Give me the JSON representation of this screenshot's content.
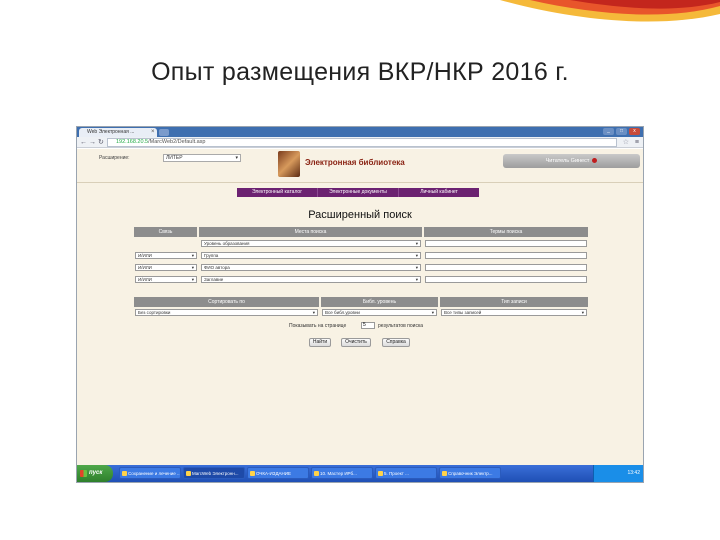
{
  "slide": {
    "title": "Опыт размещения ВКР/НКР 2016 г."
  },
  "browser": {
    "tab_title": "Web Электронная ...",
    "url_host": "192.168.20.5",
    "url_rest": "/MarcWeb2/Default.asp",
    "window_buttons": [
      "_",
      "□",
      "x"
    ]
  },
  "page": {
    "lang_label": "Расширение:",
    "lang_value": "ЛИТЕР",
    "library_title": "Электронная библиотека",
    "reader_button": "Читатель Gинест",
    "menu": [
      "Электронный каталог",
      "Электронные документы",
      "Личный кабинет"
    ],
    "search_title": "Расширенный поиск",
    "headers": {
      "logic": "Связь",
      "field": "Места поиска",
      "term": "Термы поиска"
    },
    "logic_values": [
      "И/ИЛИ",
      "И/ИЛИ",
      "И/ИЛИ"
    ],
    "field_values": [
      "Уровень образования",
      "Группа",
      "ФИО автора",
      "Заглавие"
    ],
    "sort_headers": {
      "sort": "Сортировать по",
      "level": "Библ. уровень",
      "type": "Тип записи"
    },
    "sort_values": {
      "sort": "Без сортировки",
      "level": "Все библ.уровни",
      "type": "Все типы записей"
    },
    "pager_label": "Показывать на странице",
    "pager_value": "5",
    "pager_after": "результатов поиска",
    "buttons": {
      "find": "Найти",
      "clear": "Очистить",
      "help": "Справка"
    }
  },
  "taskbar": {
    "start": "пуск",
    "tasks": [
      "Сохранение и лечение ...",
      "MarcWeb Электронн...",
      "ОЧКА-ИЗДАНИЕ",
      "10. Мастер ИРб...",
      "5. Проект ...",
      "Справочник Электр..."
    ],
    "clock": "13:42"
  },
  "colors": {
    "menu_bg": "#6c2271",
    "title_red": "#8a2313",
    "header_gray": "#8d8d8d",
    "taskbar": "#1f4fb5"
  }
}
